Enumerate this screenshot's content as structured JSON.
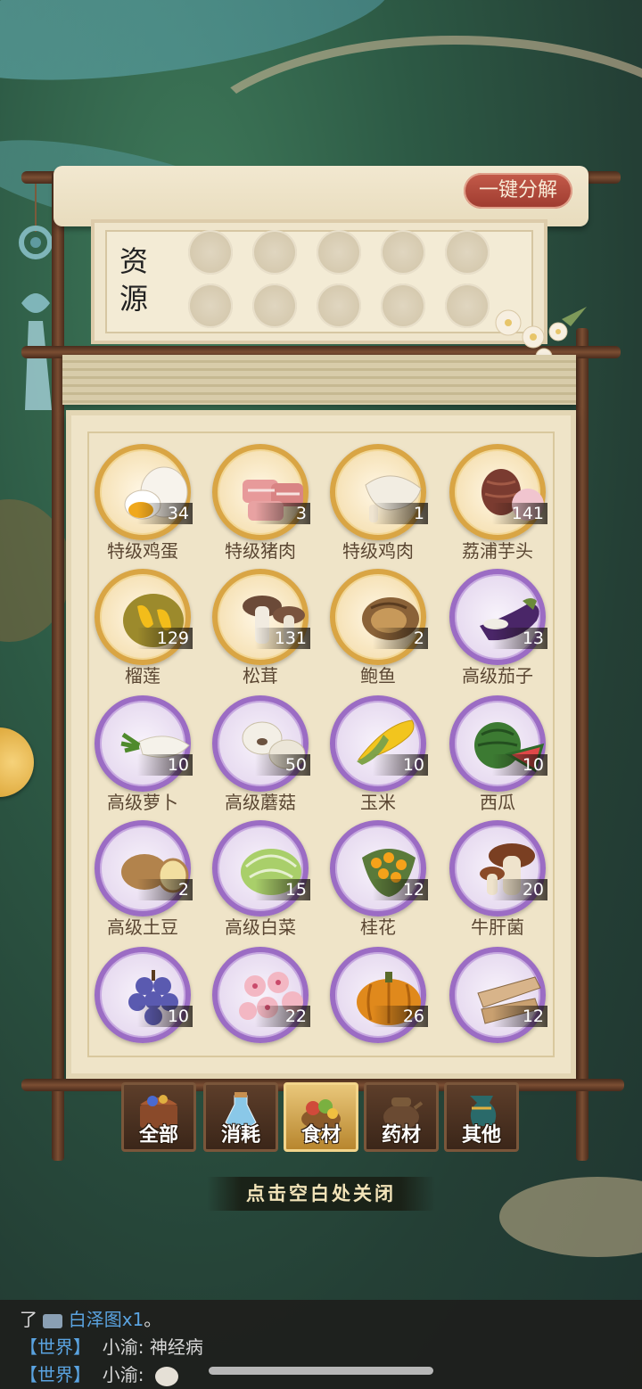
{
  "header": {
    "decompose_label": "一键分解"
  },
  "resource": {
    "title": "资源"
  },
  "items": [
    {
      "name": "特级鸡蛋",
      "count": "34",
      "rarity": "gold",
      "icon": "egg-icon"
    },
    {
      "name": "特级猪肉",
      "count": "3",
      "rarity": "gold",
      "icon": "pork-icon"
    },
    {
      "name": "特级鸡肉",
      "count": "1",
      "rarity": "gold",
      "icon": "chicken-icon"
    },
    {
      "name": "荔浦芋头",
      "count": "141",
      "rarity": "gold",
      "icon": "taro-icon"
    },
    {
      "name": "榴莲",
      "count": "129",
      "rarity": "gold",
      "icon": "durian-icon"
    },
    {
      "name": "松茸",
      "count": "131",
      "rarity": "gold",
      "icon": "matsutake-icon"
    },
    {
      "name": "鲍鱼",
      "count": "2",
      "rarity": "gold",
      "icon": "abalone-icon"
    },
    {
      "name": "高级茄子",
      "count": "13",
      "rarity": "purple",
      "icon": "eggplant-icon"
    },
    {
      "name": "高级萝卜",
      "count": "10",
      "rarity": "purple",
      "icon": "radish-icon"
    },
    {
      "name": "高级蘑菇",
      "count": "50",
      "rarity": "purple",
      "icon": "mushroom-icon"
    },
    {
      "name": "玉米",
      "count": "10",
      "rarity": "purple",
      "icon": "corn-icon"
    },
    {
      "name": "西瓜",
      "count": "10",
      "rarity": "purple",
      "icon": "watermelon-icon"
    },
    {
      "name": "高级土豆",
      "count": "2",
      "rarity": "purple",
      "icon": "potato-icon"
    },
    {
      "name": "高级白菜",
      "count": "15",
      "rarity": "purple",
      "icon": "cabbage-icon"
    },
    {
      "name": "桂花",
      "count": "12",
      "rarity": "purple",
      "icon": "osmanthus-icon"
    },
    {
      "name": "牛肝菌",
      "count": "20",
      "rarity": "purple",
      "icon": "porcini-icon"
    },
    {
      "name": "",
      "count": "10",
      "rarity": "purple",
      "icon": "grape-icon"
    },
    {
      "name": "",
      "count": "22",
      "rarity": "purple",
      "icon": "peach-blossom-icon"
    },
    {
      "name": "",
      "count": "26",
      "rarity": "purple",
      "icon": "pumpkin-icon"
    },
    {
      "name": "",
      "count": "12",
      "rarity": "purple",
      "icon": "bamboo-shoot-icon"
    }
  ],
  "tabs": [
    {
      "label": "全部",
      "icon": "chest-icon",
      "active": false
    },
    {
      "label": "消耗",
      "icon": "potion-icon",
      "active": false
    },
    {
      "label": "食材",
      "icon": "food-basket-icon",
      "active": true
    },
    {
      "label": "药材",
      "icon": "herb-pot-icon",
      "active": false
    },
    {
      "label": "其他",
      "icon": "urn-icon",
      "active": false
    }
  ],
  "close_hint": "点击空白处关闭",
  "chat": {
    "line1_prefix": "了",
    "line1_link": "白泽图x1",
    "line1_suffix": "。",
    "line2_channel": "【世界】",
    "line2_user": "小渝:",
    "line2_text": "神经病",
    "line3_channel": "【世界】",
    "line3_user": "小渝:"
  },
  "colors": {
    "gold_ring": "#d9a544",
    "purple_ring": "#9b6cc4",
    "accent_button": "#b64a3c"
  }
}
